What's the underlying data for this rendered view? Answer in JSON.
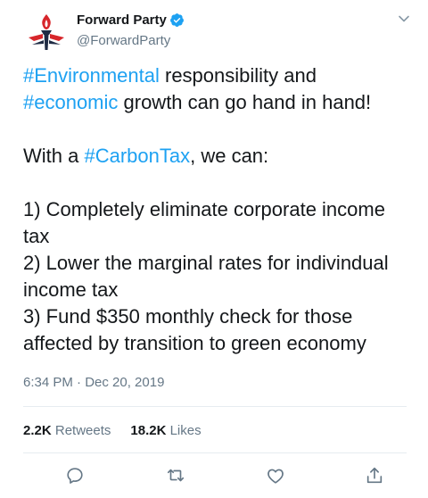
{
  "author": {
    "name": "Forward Party",
    "handle": "@ForwardParty",
    "verified": true
  },
  "tweet": {
    "p1": [
      {
        "text": "#Environmental",
        "tag": true
      },
      {
        "text": " responsibility and ",
        "tag": false
      },
      {
        "text": "#economic",
        "tag": true
      },
      {
        "text": " growth can go hand in hand!",
        "tag": false
      }
    ],
    "p2": [
      {
        "text": "With a ",
        "tag": false
      },
      {
        "text": "#CarbonTax",
        "tag": true
      },
      {
        "text": ", we can:",
        "tag": false
      }
    ],
    "p3": [
      {
        "text": "1) Completely eliminate corporate income tax",
        "tag": false
      }
    ],
    "p4": [
      {
        "text": "2) Lower the marginal rates for indivindual income tax",
        "tag": false
      }
    ],
    "p5": [
      {
        "text": "3) Fund $350 monthly check for those affected by transition to green economy",
        "tag": false
      }
    ]
  },
  "timestamp": "6:34 PM · Dec 20, 2019",
  "stats": {
    "retweets_count": "2.2K",
    "retweets_label": "Retweets",
    "likes_count": "18.2K",
    "likes_label": "Likes"
  },
  "colors": {
    "link": "#1da1f2",
    "muted": "#657786",
    "text": "#14171a",
    "verified": "#1da1f2",
    "logo_red": "#d7262b",
    "logo_dark": "#1f2b44"
  },
  "icons": {
    "reply": "reply-icon",
    "retweet": "retweet-icon",
    "like": "heart-icon",
    "share": "share-icon",
    "more": "chevron-down-icon",
    "verified": "verified-badge-icon"
  }
}
